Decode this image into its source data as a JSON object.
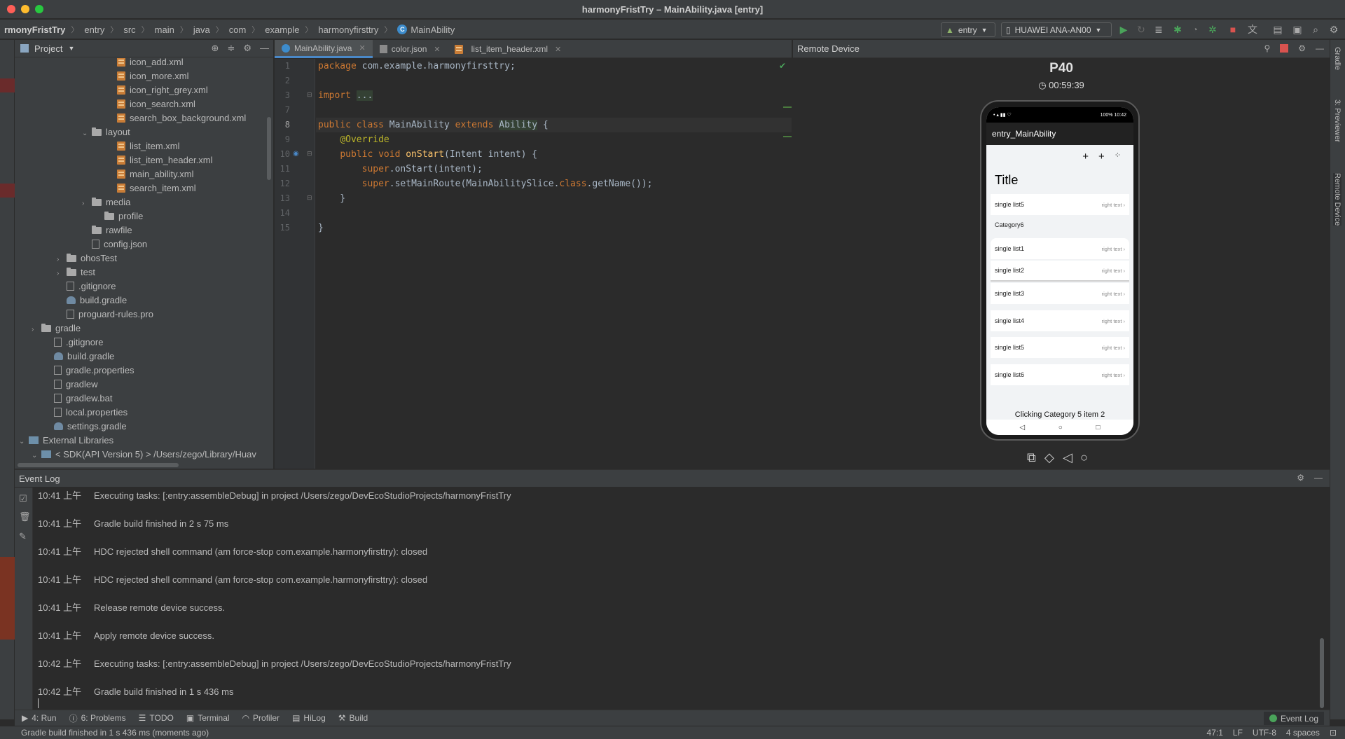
{
  "window": {
    "title": "harmonyFristTry – MainAbility.java [entry]",
    "traffic_colors": [
      "#ff5f57",
      "#febc2e",
      "#28c840"
    ]
  },
  "breadcrumb": [
    "rmonyFristTry",
    "entry",
    "src",
    "main",
    "java",
    "com",
    "example",
    "harmonyfirsttry",
    "MainAbility"
  ],
  "toolbar": {
    "module": "entry",
    "device": "HUAWEI ANA-AN00",
    "icons": [
      "hammer-icon",
      "run-icon",
      "rerun-icon",
      "attach-icon",
      "debug-icon",
      "profile-icon",
      "stop-icon",
      "translate-icon",
      "folder-icon",
      "layout-icon",
      "search-icon"
    ]
  },
  "project": {
    "title": "Project",
    "tree": [
      {
        "label": "icon_add.xml",
        "kind": "xml",
        "indent": 7
      },
      {
        "label": "icon_more.xml",
        "kind": "xml",
        "indent": 7
      },
      {
        "label": "icon_right_grey.xml",
        "kind": "xml",
        "indent": 7
      },
      {
        "label": "icon_search.xml",
        "kind": "xml",
        "indent": 7
      },
      {
        "label": "search_box_background.xml",
        "kind": "xml",
        "indent": 7
      },
      {
        "label": "layout",
        "kind": "folder-open",
        "indent": 5
      },
      {
        "label": "list_item.xml",
        "kind": "xml",
        "indent": 7
      },
      {
        "label": "list_item_header.xml",
        "kind": "xml",
        "indent": 7
      },
      {
        "label": "main_ability.xml",
        "kind": "xml",
        "indent": 7
      },
      {
        "label": "search_item.xml",
        "kind": "xml",
        "indent": 7
      },
      {
        "label": "media",
        "kind": "folder-closed",
        "indent": 5
      },
      {
        "label": "profile",
        "kind": "folder",
        "indent": 6
      },
      {
        "label": "rawfile",
        "kind": "folder",
        "indent": 5
      },
      {
        "label": "config.json",
        "kind": "file",
        "indent": 5
      },
      {
        "label": "ohosTest",
        "kind": "folder-closed",
        "indent": 3
      },
      {
        "label": "test",
        "kind": "folder-closed",
        "indent": 3
      },
      {
        "label": ".gitignore",
        "kind": "file",
        "indent": 3
      },
      {
        "label": "build.gradle",
        "kind": "gradle",
        "indent": 3
      },
      {
        "label": "proguard-rules.pro",
        "kind": "file",
        "indent": 3
      },
      {
        "label": "gradle",
        "kind": "folder-closed",
        "indent": 1
      },
      {
        "label": ".gitignore",
        "kind": "file",
        "indent": 2
      },
      {
        "label": "build.gradle",
        "kind": "gradle",
        "indent": 2
      },
      {
        "label": "gradle.properties",
        "kind": "file",
        "indent": 2
      },
      {
        "label": "gradlew",
        "kind": "file",
        "indent": 2
      },
      {
        "label": "gradlew.bat",
        "kind": "file",
        "indent": 2
      },
      {
        "label": "local.properties",
        "kind": "file",
        "indent": 2
      },
      {
        "label": "settings.gradle",
        "kind": "gradle",
        "indent": 2
      },
      {
        "label": "External Libraries",
        "kind": "lib-open",
        "indent": 0
      },
      {
        "label": "< SDK(API Version 5) > /Users/zego/Library/Huav",
        "kind": "lib-open",
        "indent": 1
      }
    ]
  },
  "editor": {
    "tabs": [
      {
        "label": "MainAbility.java",
        "active": true
      },
      {
        "label": "color.json",
        "active": false
      },
      {
        "label": "list_item_header.xml",
        "active": false
      }
    ],
    "line_numbers": [
      "1",
      "2",
      "3",
      "7",
      "8",
      "9",
      "10",
      "11",
      "12",
      "13",
      "14",
      "15"
    ],
    "current_line": "8"
  },
  "remote": {
    "title": "Remote Device",
    "device_name": "P40",
    "timer": "00:59:39",
    "phone": {
      "status_right": "100% 10:42",
      "app_title": "entry_MainAbility",
      "page_title": "Title",
      "items": [
        {
          "label": "single list5",
          "right": "right text"
        },
        {
          "label": "single list1",
          "right": "right text"
        },
        {
          "label": "single list2",
          "right": "right text"
        },
        {
          "label": "single list3",
          "right": "right text"
        },
        {
          "label": "single list4",
          "right": "right text"
        },
        {
          "label": "single list5",
          "right": "right text"
        },
        {
          "label": "single list6",
          "right": "right text"
        }
      ],
      "category": "Category6",
      "toast": "Clicking Category 5 item 2"
    }
  },
  "right_stripe": [
    "Gradle",
    "3: Previewer",
    "Remote Device"
  ],
  "eventlog": {
    "title": "Event Log",
    "lines": [
      {
        "time": "10:41 上午",
        "text": "Executing tasks: [:entry:assembleDebug] in project /Users/zego/DevEcoStudioProjects/harmonyFristTry"
      },
      {
        "time": "10:41 上午",
        "text": "Gradle build finished in 2 s 75 ms"
      },
      {
        "time": "10:41 上午",
        "text": "HDC rejected shell command (am force-stop com.example.harmonyfirsttry): closed"
      },
      {
        "time": "10:41 上午",
        "text": "HDC rejected shell command (am force-stop com.example.harmonyfirsttry): closed"
      },
      {
        "time": "10:41 上午",
        "text": "Release remote device success."
      },
      {
        "time": "10:41 上午",
        "text": "Apply remote device success."
      },
      {
        "time": "10:42 上午",
        "text": "Executing tasks: [:entry:assembleDebug] in project /Users/zego/DevEcoStudioProjects/harmonyFristTry"
      },
      {
        "time": "10:42 上午",
        "text": "Gradle build finished in 1 s 436 ms"
      }
    ]
  },
  "bottom_tools": {
    "run": "4: Run",
    "problems": "6: Problems",
    "todo": "TODO",
    "terminal": "Terminal",
    "profiler": "Profiler",
    "hilog": "HiLog",
    "build": "Build",
    "event_log": "Event Log"
  },
  "status": {
    "message": "Gradle build finished in 1 s 436 ms (moments ago)",
    "position": "47:1",
    "line_sep": "LF",
    "encoding": "UTF-8",
    "indent": "4 spaces"
  }
}
